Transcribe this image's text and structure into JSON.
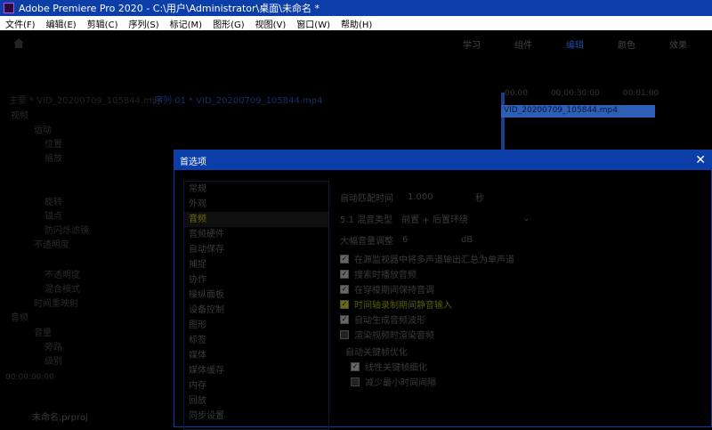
{
  "title": "Adobe Premiere Pro 2020 - C:\\用户\\Administrator\\桌面\\未命名 *",
  "menu": [
    "文件(F)",
    "编辑(E)",
    "剪辑(C)",
    "序列(S)",
    "标记(M)",
    "图形(G)",
    "视图(V)",
    "窗口(W)",
    "帮助(H)"
  ],
  "workspaces": [
    "学习",
    "组件",
    "编辑",
    "颜色",
    "效果"
  ],
  "active_workspace": "编辑",
  "source_label": "主要 * VID_20200709_105844.mp4",
  "sequence_label": "序列 01 * VID_20200709_105844.mp4",
  "effect_tree": [
    "视频",
    "运动",
    "位置",
    "缩放",
    "旋转",
    "锚点",
    "防闪烁滤镜",
    "不透明度",
    "不透明度",
    "混合模式",
    "时间重映射",
    "音频",
    "音量",
    "旁路",
    "级别"
  ],
  "timecode": "00:00:00:00",
  "project_file": "未命名.prproj",
  "timeline": {
    "ruler": [
      "00:00",
      "00:00:30:00",
      "00:01:00"
    ],
    "clip": "VID_20200709_105844.mp4"
  },
  "dialog": {
    "title": "首选项",
    "categories": [
      "常规",
      "外观",
      "音频",
      "音频硬件",
      "自动保存",
      "捕捉",
      "协作",
      "操纵面板",
      "设备控制",
      "图形",
      "标签",
      "媒体",
      "媒体缓存",
      "内存",
      "回放",
      "同步设置"
    ],
    "selected": "音频",
    "auto_match_label": "自动匹配时间",
    "auto_match_value": "1.000",
    "auto_match_unit": "秒",
    "mix_label": "5.1 混音类型",
    "mix_value": "前置 + 后置环绕",
    "volume_label": "大幅音量调整",
    "volume_value": "6",
    "volume_unit": "dB",
    "checks": [
      {
        "label": "在源监视器中将多声道输出汇总为单声道",
        "checked": true
      },
      {
        "label": "搜索时播放音频",
        "checked": true
      },
      {
        "label": "在穿梭期间保持音调",
        "checked": true
      },
      {
        "label": "时间轴录制期间静音输入",
        "checked": true
      },
      {
        "label": "自动生成音频波形",
        "checked": true
      },
      {
        "label": "渲染视频时渲染音频",
        "checked": false
      }
    ],
    "keyframe_group": "自动关键帧优化",
    "sub_checks": [
      {
        "label": "线性关键帧细化",
        "checked": true
      },
      {
        "label": "减少最小时间间隔",
        "checked": false
      }
    ]
  }
}
